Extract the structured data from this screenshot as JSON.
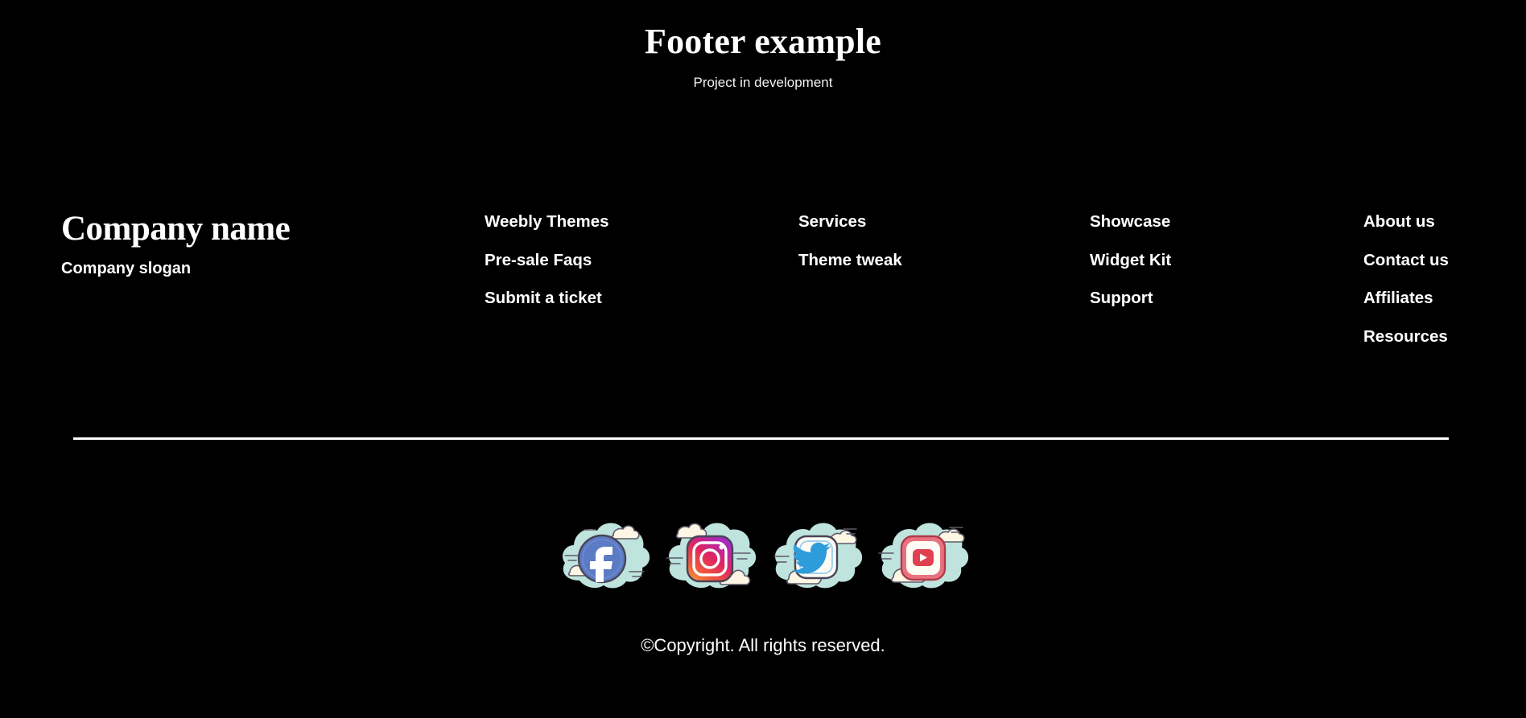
{
  "header": {
    "title": "Footer example",
    "subtitle": "Project in development"
  },
  "company": {
    "name": "Company name",
    "slogan": "Company slogan"
  },
  "columns": [
    {
      "name": "weebly-themes",
      "links": [
        {
          "label": "Weebly Themes"
        },
        {
          "label": "Pre-sale Faqs"
        },
        {
          "label": "Submit a ticket"
        }
      ]
    },
    {
      "name": "services",
      "links": [
        {
          "label": "Services"
        },
        {
          "label": "Theme tweak"
        }
      ]
    },
    {
      "name": "showcase",
      "links": [
        {
          "label": "Showcase"
        },
        {
          "label": "Widget Kit"
        },
        {
          "label": "Support"
        }
      ]
    },
    {
      "name": "about",
      "links": [
        {
          "label": "About us"
        },
        {
          "label": "Contact us"
        },
        {
          "label": "Affiliates"
        },
        {
          "label": "Resources"
        }
      ]
    }
  ],
  "social": [
    {
      "icon": "facebook-icon",
      "label": "Facebook"
    },
    {
      "icon": "instagram-icon",
      "label": "Instagram"
    },
    {
      "icon": "twitter-icon",
      "label": "Twitter"
    },
    {
      "icon": "youtube-icon",
      "label": "YouTube"
    }
  ],
  "copyright": "©Copyright. All rights reserved.",
  "colors": {
    "background": "#000000",
    "text": "#ffffff",
    "divider": "#ffffff",
    "cloud_mint": "#bfe3dd",
    "cloud_cream": "#fdf6e4",
    "cloud_outline": "#5d5a6b",
    "facebook_blue": "#5b7bc4",
    "instagram_purple": "#c42aa0",
    "instagram_orange": "#f58529",
    "twitter_blue": "#2d9cdb",
    "youtube_red": "#e04f5f"
  }
}
